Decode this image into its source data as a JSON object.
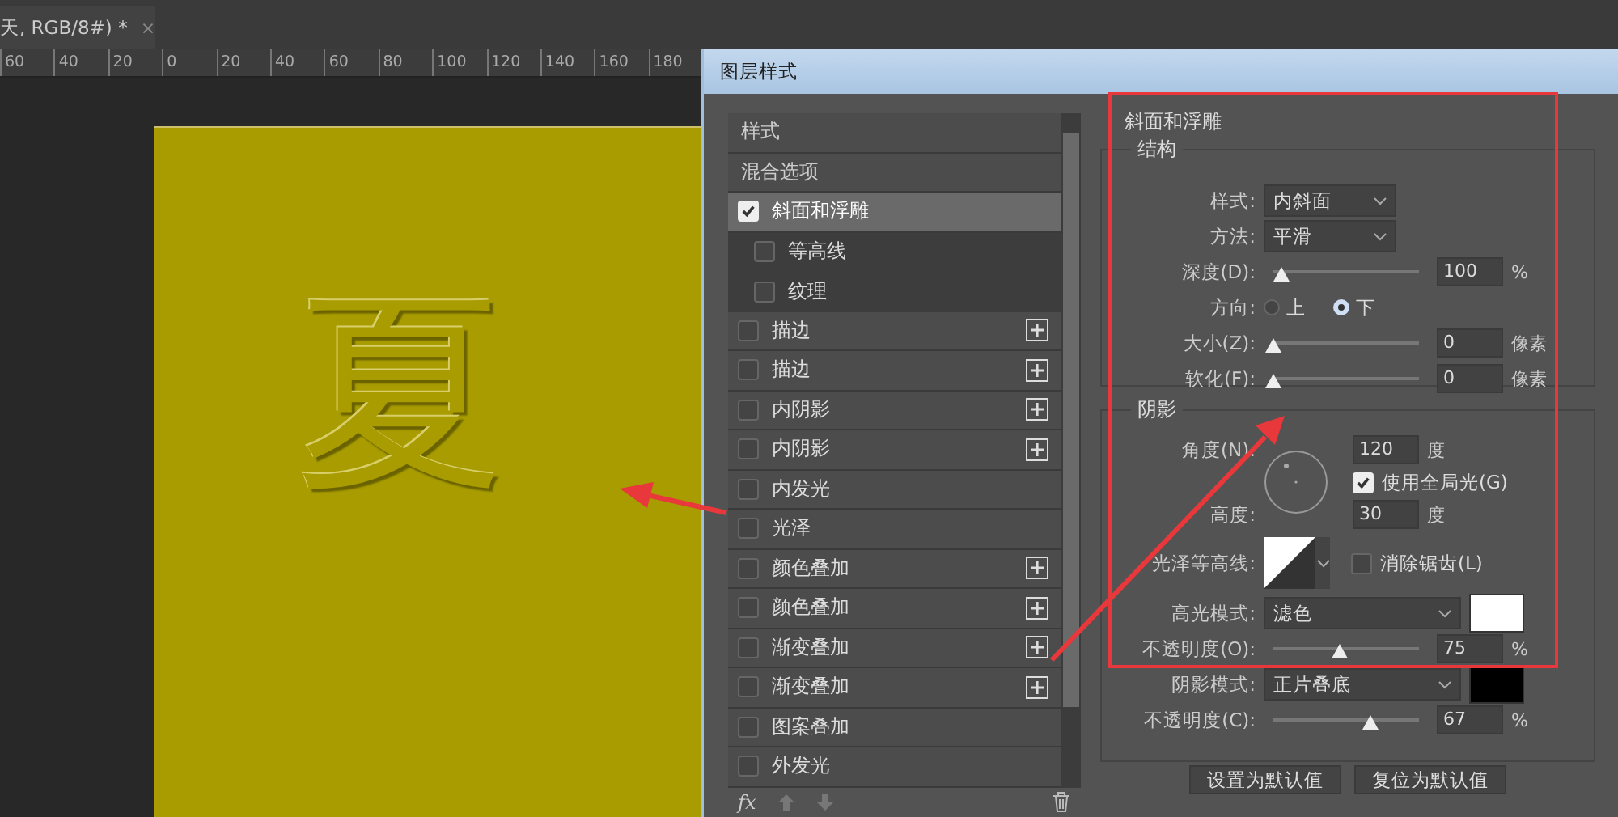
{
  "document_tab": {
    "title": "天, RGB/8#) *",
    "close": "×"
  },
  "ruler": {
    "ticks": [
      "60",
      "40",
      "20",
      "0",
      "20",
      "40",
      "60",
      "80",
      "100",
      "120",
      "140",
      "160",
      "180"
    ]
  },
  "canvas": {
    "text": "夏"
  },
  "dialog": {
    "title": "图层样式",
    "styles": [
      {
        "label": "样式",
        "kind": "header",
        "selected": false
      },
      {
        "label": "混合选项",
        "kind": "header",
        "selected": false
      },
      {
        "label": "斜面和浮雕",
        "kind": "effect",
        "checked": true,
        "selected": true,
        "addable": false,
        "children": [
          {
            "label": "等高线",
            "checked": false,
            "selected": false
          },
          {
            "label": "纹理",
            "checked": false,
            "selected": false
          }
        ]
      },
      {
        "label": "描边",
        "kind": "effect",
        "checked": false,
        "selected": false,
        "addable": true
      },
      {
        "label": "描边",
        "kind": "effect",
        "checked": false,
        "selected": false,
        "addable": true
      },
      {
        "label": "内阴影",
        "kind": "effect",
        "checked": false,
        "selected": false,
        "addable": true
      },
      {
        "label": "内阴影",
        "kind": "effect",
        "checked": false,
        "selected": false,
        "addable": true
      },
      {
        "label": "内发光",
        "kind": "effect",
        "checked": false,
        "selected": false,
        "addable": false
      },
      {
        "label": "光泽",
        "kind": "effect",
        "checked": false,
        "selected": false,
        "addable": false
      },
      {
        "label": "颜色叠加",
        "kind": "effect",
        "checked": false,
        "selected": false,
        "addable": true
      },
      {
        "label": "颜色叠加",
        "kind": "effect",
        "checked": false,
        "selected": false,
        "addable": true
      },
      {
        "label": "渐变叠加",
        "kind": "effect",
        "checked": false,
        "selected": false,
        "addable": true
      },
      {
        "label": "渐变叠加",
        "kind": "effect",
        "checked": false,
        "selected": false,
        "addable": true
      },
      {
        "label": "图案叠加",
        "kind": "effect",
        "checked": false,
        "selected": false,
        "addable": false
      },
      {
        "label": "外发光",
        "kind": "effect",
        "checked": false,
        "selected": false,
        "addable": false
      }
    ],
    "toolbar": {
      "fx": "fx"
    },
    "bevel": {
      "title": "斜面和浮雕",
      "structure": {
        "title": "结构",
        "rows": [
          {
            "kind": "dropdown",
            "label": "样式:",
            "value": "内斜面"
          },
          {
            "kind": "dropdown",
            "label": "方法:",
            "value": "平滑"
          },
          {
            "kind": "slider",
            "label": "深度(D):",
            "level": 0.05,
            "value": "100",
            "unit": "%"
          },
          {
            "kind": "radio",
            "label": "方向:",
            "options": [
              {
                "label": "上",
                "selected": false
              },
              {
                "label": "下",
                "selected": true
              }
            ]
          },
          {
            "kind": "slider",
            "label": "大小(Z):",
            "level": 0,
            "value": "0",
            "unit": "像素"
          },
          {
            "kind": "slider",
            "label": "软化(F):",
            "level": 0,
            "value": "0",
            "unit": "像素"
          }
        ]
      },
      "shading": {
        "title": "阴影",
        "angle": {
          "label": "角度(N):",
          "value": "120",
          "unit": "度"
        },
        "global_light": {
          "label": "使用全局光(G)",
          "checked": true
        },
        "altitude": {
          "label": "高度:",
          "value": "30",
          "unit": "度"
        },
        "gloss_contour": {
          "label": "光泽等高线:"
        },
        "anti_alias": {
          "label": "消除锯齿(L)",
          "checked": false
        },
        "highlight": {
          "label": "高光模式:",
          "mode": "滤色",
          "color": "#ffffff"
        },
        "highlight_opacity": {
          "label": "不透明度(O):",
          "level": 0.45,
          "value": "75",
          "unit": "%"
        },
        "shadow": {
          "label": "阴影模式:",
          "mode": "正片叠底",
          "color": "#000000"
        },
        "shadow_opacity": {
          "label": "不透明度(C):",
          "level": 0.67,
          "value": "67",
          "unit": "%"
        }
      }
    },
    "buttons": [
      "设置为默认值",
      "复位为默认值"
    ]
  }
}
